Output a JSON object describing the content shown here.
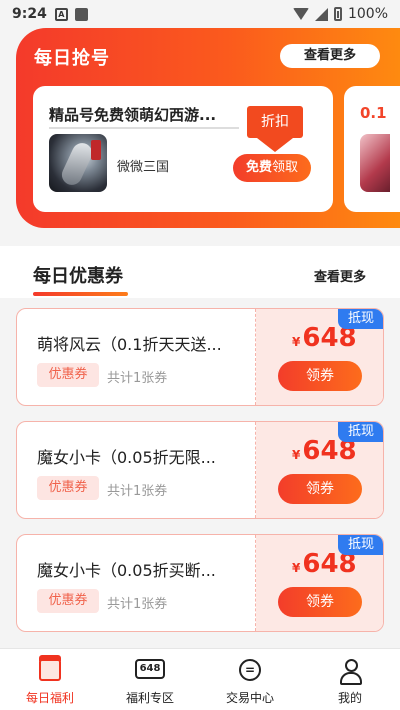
{
  "status_bar": {
    "time": "9:24",
    "battery": "100%"
  },
  "daily_accounts": {
    "title": "每日抢号",
    "more": "查看更多",
    "card": {
      "title": "精品号免费领萌幻西游...",
      "game": "微微三国",
      "discount_tag": "折扣",
      "claim_bold": "免费",
      "claim_rest": "领取"
    },
    "peek_title": "0.1"
  },
  "coupons_section": {
    "title": "每日优惠券",
    "more": "查看更多",
    "items": [
      {
        "name": "萌将风云（0.1折天天送...",
        "tag": "优惠券",
        "count": "共计1张券",
        "currency": "¥",
        "value": "648",
        "button": "领券",
        "type": "抵现"
      },
      {
        "name": "魔女小卡（0.05折无限...",
        "tag": "优惠券",
        "count": "共计1张券",
        "currency": "¥",
        "value": "648",
        "button": "领券",
        "type": "抵现"
      },
      {
        "name": "魔女小卡（0.05折买断...",
        "tag": "优惠券",
        "count": "共计1张券",
        "currency": "¥",
        "value": "648",
        "button": "领券",
        "type": "抵现"
      }
    ]
  },
  "bottom_nav": {
    "items": [
      {
        "label": "每日福利",
        "icon": "shop-icon",
        "active": true
      },
      {
        "label": "福利专区",
        "icon": "648-icon",
        "icon_text": "648",
        "active": false
      },
      {
        "label": "交易中心",
        "icon": "trade-icon",
        "icon_text": "=",
        "active": false
      },
      {
        "label": "我的",
        "icon": "user-icon",
        "active": false
      }
    ]
  },
  "colors": {
    "brand_red": "#f0321f",
    "brand_orange": "#fd6c1c",
    "badge_blue": "#2f7bf0"
  }
}
